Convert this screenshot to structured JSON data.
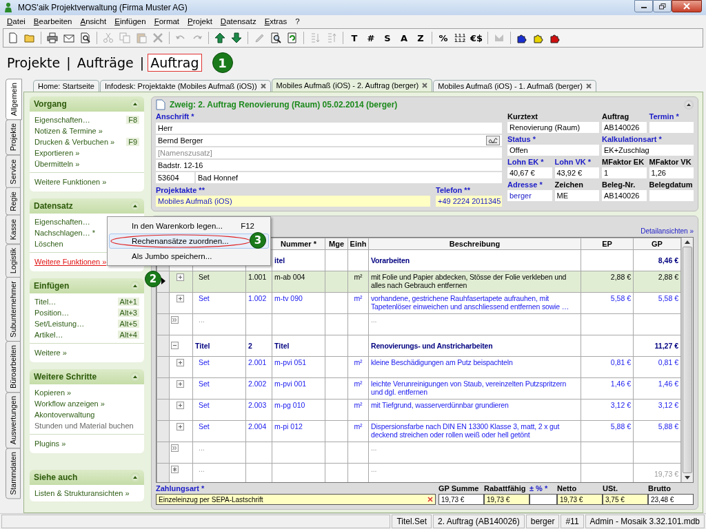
{
  "window": {
    "title": "MOS'aik Projektverwaltung (Firma Muster AG)"
  },
  "menu": [
    "Datei",
    "Bearbeiten",
    "Ansicht",
    "Einfügen",
    "Format",
    "Projekt",
    "Datensatz",
    "Extras",
    "?"
  ],
  "toolbar": [
    {
      "kind": "new",
      "disabled": false
    },
    {
      "kind": "open",
      "disabled": false
    },
    {
      "kind": "sep"
    },
    {
      "kind": "print",
      "disabled": false
    },
    {
      "kind": "mail",
      "disabled": false
    },
    {
      "kind": "preview",
      "disabled": false
    },
    {
      "kind": "sep"
    },
    {
      "kind": "cut",
      "disabled": true
    },
    {
      "kind": "copy",
      "disabled": true
    },
    {
      "kind": "paste",
      "disabled": true
    },
    {
      "kind": "delete",
      "disabled": true
    },
    {
      "kind": "sep"
    },
    {
      "kind": "undo",
      "disabled": true
    },
    {
      "kind": "redo",
      "disabled": true
    },
    {
      "kind": "sep"
    },
    {
      "kind": "up",
      "disabled": false
    },
    {
      "kind": "down",
      "disabled": false
    },
    {
      "kind": "sep"
    },
    {
      "kind": "pencil",
      "disabled": true
    },
    {
      "kind": "find",
      "disabled": false
    },
    {
      "kind": "refresh",
      "disabled": false
    },
    {
      "kind": "sep"
    },
    {
      "kind": "sortaz",
      "disabled": true
    },
    {
      "kind": "sortza",
      "disabled": true
    },
    {
      "kind": "sep"
    },
    {
      "kind": "text",
      "label": "T",
      "disabled": false
    },
    {
      "kind": "text",
      "label": "#",
      "disabled": false
    },
    {
      "kind": "text",
      "label": "S",
      "disabled": false
    },
    {
      "kind": "text",
      "label": "A",
      "disabled": false
    },
    {
      "kind": "text",
      "label": "Z",
      "disabled": false
    },
    {
      "kind": "sep"
    },
    {
      "kind": "text",
      "label": "%",
      "disabled": false
    },
    {
      "kind": "stack",
      "lines": [
        "1.1.1",
        "1.1.2"
      ],
      "disabled": false
    },
    {
      "kind": "text",
      "label": "€$",
      "disabled": false
    },
    {
      "kind": "sep"
    },
    {
      "kind": "tool",
      "disabled": true
    },
    {
      "kind": "sep"
    },
    {
      "kind": "puzzle",
      "color": "#1a2fd0",
      "disabled": false
    },
    {
      "kind": "puzzle",
      "color": "#e8d400",
      "disabled": false
    },
    {
      "kind": "puzzle",
      "color": "#d01010",
      "disabled": false
    }
  ],
  "breadcrumb": {
    "separator": "|",
    "items": [
      {
        "label": "Projekte",
        "selected": false
      },
      {
        "label": "Aufträge",
        "selected": false
      },
      {
        "label": "Auftrag",
        "selected": true
      }
    ]
  },
  "callouts": [
    "1",
    "2",
    "3"
  ],
  "side_tabs": [
    {
      "label": "Allgemein",
      "selected": true
    },
    {
      "label": "Projekte",
      "selected": false
    },
    {
      "label": "Service",
      "selected": false
    },
    {
      "label": "Regie",
      "selected": false
    },
    {
      "label": "Kasse",
      "selected": false
    },
    {
      "label": "Logistik",
      "selected": false
    },
    {
      "label": "Subunternehmer",
      "selected": false
    },
    {
      "label": "Büroarbeiten",
      "selected": false
    },
    {
      "label": "Auswertungen",
      "selected": false
    },
    {
      "label": "Stammdaten",
      "selected": false
    }
  ],
  "doc_tabs": [
    {
      "label": "Home: Startseite",
      "selected": false,
      "closable": false
    },
    {
      "label": "Infodesk: Projektakte (Mobiles Aufmaß (iOS))",
      "selected": false,
      "closable": true
    },
    {
      "label": "Mobiles Aufmaß (iOS) - 2. Auftrag (berger)",
      "selected": true,
      "closable": true
    },
    {
      "label": "Mobiles Aufmaß (iOS) - 1. Aufmaß (berger)",
      "selected": false,
      "closable": true
    }
  ],
  "sidebar": [
    {
      "title": "Vorgang",
      "expanded": true,
      "items": [
        {
          "label": "Eigenschaften…",
          "shortcut": "F8",
          "kind": "link"
        },
        {
          "label": "Notizen & Termine »",
          "kind": "link"
        },
        {
          "label": "Drucken & Verbuchen »",
          "shortcut": "F9",
          "kind": "link"
        },
        {
          "label": "Exportieren »",
          "kind": "link"
        },
        {
          "label": "Übermitteln »",
          "kind": "link"
        }
      ],
      "extra": [
        {
          "label": "Weitere Funktionen »",
          "kind": "link"
        }
      ]
    },
    {
      "title": "Datensatz",
      "expanded": true,
      "items": [
        {
          "label": "Eigenschaften…",
          "kind": "link"
        },
        {
          "label": "Nachschlagen… *",
          "kind": "link"
        },
        {
          "label": "Löschen",
          "kind": "link"
        }
      ],
      "extra": [
        {
          "label": "Weitere Funktionen »",
          "kind": "hover"
        }
      ]
    },
    {
      "title": "Einfügen",
      "expanded": true,
      "items": [
        {
          "label": "Titel…",
          "shortcut": "Alt+1",
          "kind": "link"
        },
        {
          "label": "Position…",
          "shortcut": "Alt+3",
          "kind": "link"
        },
        {
          "label": "Set/Leistung…",
          "shortcut": "Alt+5",
          "kind": "link"
        },
        {
          "label": "Artikel…",
          "shortcut": "Alt+4",
          "kind": "link"
        }
      ],
      "extra": [
        {
          "label": "Weitere »",
          "kind": "link"
        }
      ]
    },
    {
      "title": "Weitere Schritte",
      "expanded": true,
      "items": [
        {
          "label": "Kopieren »",
          "kind": "link"
        },
        {
          "label": "Workflow anzeigen »",
          "kind": "link"
        },
        {
          "label": "Akontoverwaltung",
          "kind": "link"
        },
        {
          "label": "Stunden und Material buchen",
          "kind": "muted"
        }
      ],
      "extra": [
        {
          "label": "Plugins »",
          "kind": "link"
        }
      ]
    },
    {
      "title": "Siehe auch",
      "expanded": true,
      "items": [
        {
          "label": "Listen & Strukturansichten »",
          "kind": "link"
        }
      ]
    }
  ],
  "record": {
    "title": "Zweig: 2. Auftrag Renovierung (Raum) 05.02.2014 (berger)",
    "expanded": true,
    "address": {
      "label": "Anschrift *",
      "lines": [
        {
          "value": "Herr",
          "has_button": false
        },
        {
          "value": "Bernd Berger",
          "has_button": true
        },
        {
          "placeholder": "[Namenszusatz]"
        },
        {
          "value": "Badstr. 12-16",
          "has_button": false
        }
      ],
      "zip": "53604",
      "city": "Bad Honnef"
    },
    "project": {
      "label": "Projektakte **",
      "value": "Mobiles Aufmaß (iOS)",
      "link": true,
      "highlighted": true
    },
    "phone": {
      "label": "Telefon **",
      "value": "+49 2224 2011345",
      "link": true,
      "highlighted": true
    },
    "fields": [
      [
        {
          "label": "Kurztext",
          "required": false,
          "value": "Renovierung (Raum)",
          "link": false
        },
        {
          "label": "Auftrag",
          "required": false,
          "value": "AB140026",
          "link": false
        },
        {
          "label": "Termin *",
          "required": true,
          "link": false
        }
      ],
      [
        {
          "label": "Status *",
          "required": true,
          "value": "Offen",
          "link": false
        },
        {
          "label": "Kalkulationsart *",
          "required": true,
          "value": "EK+Zuschlag",
          "link": false
        }
      ],
      [
        {
          "label": "Lohn EK *",
          "required": true,
          "value": "40,67 €",
          "link": false
        },
        {
          "label": "Lohn VK *",
          "required": true,
          "value": "43,92 €",
          "link": false
        },
        {
          "label": "MFaktor EK",
          "required": false,
          "value": "1",
          "link": false
        },
        {
          "label": "MFaktor VK",
          "required": false,
          "value": "1,26",
          "link": false
        }
      ],
      [
        {
          "label": "Adresse *",
          "required": true,
          "value": "berger",
          "link": true
        },
        {
          "label": "Zeichen",
          "required": false,
          "value": "ME",
          "link": false
        },
        {
          "label": "Beleg-Nr.",
          "required": false,
          "value": "AB140026",
          "link": false
        },
        {
          "label": "Belegdatum",
          "required": false,
          "link": false
        }
      ]
    ]
  },
  "positions": {
    "link": "Detailansichten »",
    "columns": [
      "Nummer *",
      "Mge",
      "Einh",
      "Beschreibung",
      "EP",
      "GP"
    ],
    "rows": [
      {
        "kind": "title",
        "selected": false,
        "nummer": "itel",
        "text": "Vorarbeiten",
        "gp": "8,46 €"
      },
      {
        "kind": "set",
        "selected": true,
        "art": "Set",
        "nr": "1.001",
        "nummer": "m-ab 004",
        "einh": "m²",
        "text": "mit Folie und Papier abdecken, Stösse der Folie verkleben und alles nach Gebrauch entfernen",
        "ep": "2,88 €",
        "gp": "2,88 €"
      },
      {
        "kind": "set",
        "selected": false,
        "art": "Set",
        "nr": "1.002",
        "nummer": "m-tv 090",
        "einh": "m²",
        "text": "vorhandene, gestrichene Rauhfasertapete aufrauhen, mit Tapetenlöser einweichen und anschliessend entfernen sowie …",
        "ep": "5,58 €",
        "gp": "5,58 €"
      },
      {
        "kind": "more",
        "selected": false,
        "art": "...",
        "text": "..."
      },
      {
        "kind": "title",
        "selected": false,
        "art": "Titel",
        "nr": "2",
        "nummer": "Titel",
        "text": "Renovierungs- und Anstricharbeiten",
        "gp": "11,27 €"
      },
      {
        "kind": "set",
        "selected": false,
        "art": "Set",
        "nr": "2.001",
        "nummer": "m-pvi 051",
        "einh": "m²",
        "text": "kleine Beschädigungen am Putz beispachteln",
        "ep": "0,81 €",
        "gp": "0,81 €"
      },
      {
        "kind": "set",
        "selected": false,
        "art": "Set",
        "nr": "2.002",
        "nummer": "m-pvi 001",
        "einh": "m²",
        "text": "leichte Verunreinigungen von Staub, vereinzelten Putzspritzern und dgl. entfernen",
        "ep": "1,46 €",
        "gp": "1,46 €"
      },
      {
        "kind": "set",
        "selected": false,
        "art": "Set",
        "nr": "2.003",
        "nummer": "m-pg 010",
        "einh": "m²",
        "text": "mit Tiefgrund, wasserverdünnbar grundieren",
        "ep": "3,12 €",
        "gp": "3,12 €"
      },
      {
        "kind": "set",
        "selected": false,
        "art": "Set",
        "nr": "2.004",
        "nummer": "m-pi 012",
        "einh": "m²",
        "text": "Dispersionsfarbe nach DIN EN 13300 Klasse 3, matt, 2 x gut deckend streichen oder rollen weiß oder hell getönt",
        "ep": "5,88 €",
        "gp": "5,88 €"
      },
      {
        "kind": "more",
        "selected": false,
        "art": "...",
        "text": "..."
      },
      {
        "kind": "new",
        "selected": false,
        "art": "...",
        "text": "...",
        "gp": "19,73 €"
      }
    ],
    "payment": {
      "label": "Zahlungsart *",
      "value": "Einzeleinzug per SEPA-Lastschrift"
    },
    "totals": [
      {
        "label": "GP Summe",
        "required": false,
        "value": "19,73 €",
        "highlighted": false
      },
      {
        "label": "Rabattfähig",
        "required": false,
        "value": "19,73 €",
        "highlighted": true
      },
      {
        "label": "± % *",
        "required": true,
        "highlighted": false
      },
      {
        "label": "Netto",
        "required": false,
        "value": "19,73 €",
        "highlighted": true
      },
      {
        "label": "USt.",
        "required": false,
        "value": "3,75 €",
        "highlighted": true
      },
      {
        "label": "Brutto",
        "required": false,
        "value": "23,48 €",
        "highlighted": false
      }
    ]
  },
  "context_menu": {
    "items": [
      {
        "label": "In den Warenkorb legen...",
        "shortcut": "F12",
        "selected": false
      },
      {
        "label": "Rechenansätze zuordnen...",
        "selected": true
      },
      {
        "label": "Als Jumbo speichern...",
        "selected": false
      }
    ]
  },
  "status_bar": [
    "Titel.Set",
    "2. Auftrag (AB140026)",
    "berger",
    "#11",
    "Admin - Mosaik 3.32.101.mdb"
  ]
}
